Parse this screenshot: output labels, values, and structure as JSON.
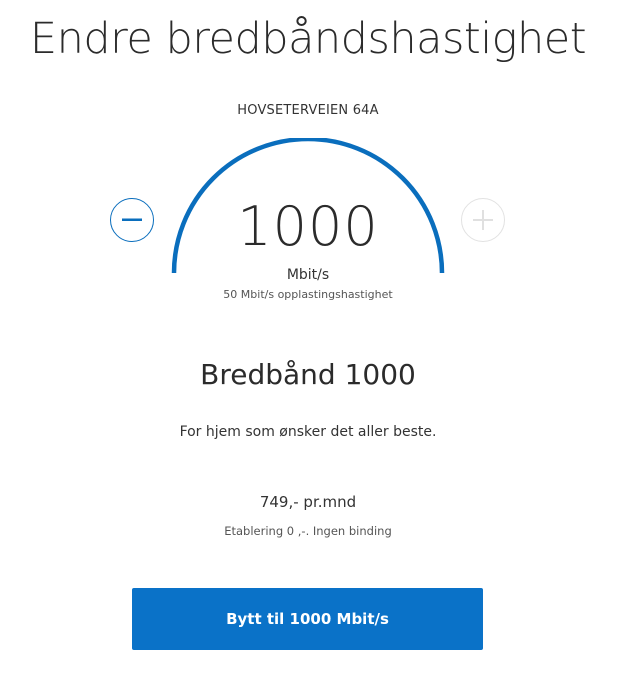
{
  "page": {
    "title": "Endre bredbåndshastighet"
  },
  "address": "HOVSETERVEIEN 64A",
  "speed": {
    "value": "1000",
    "unit": "Mbit/s",
    "upload": "50 Mbit/s opplastingshastighet",
    "decrease_icon": "minus-icon",
    "increase_icon": "plus-icon"
  },
  "product": {
    "name": "Bredbånd 1000",
    "description": "For hjem som ønsker det aller beste.",
    "price": "749,- pr.mnd",
    "terms": "Etablering 0 ,-. Ingen binding"
  },
  "cta": {
    "label": "Bytt til 1000 Mbit/s"
  },
  "colors": {
    "accent": "#0a72c8",
    "gauge": "#0a6ebd",
    "disabled": "#e2e2e2"
  }
}
